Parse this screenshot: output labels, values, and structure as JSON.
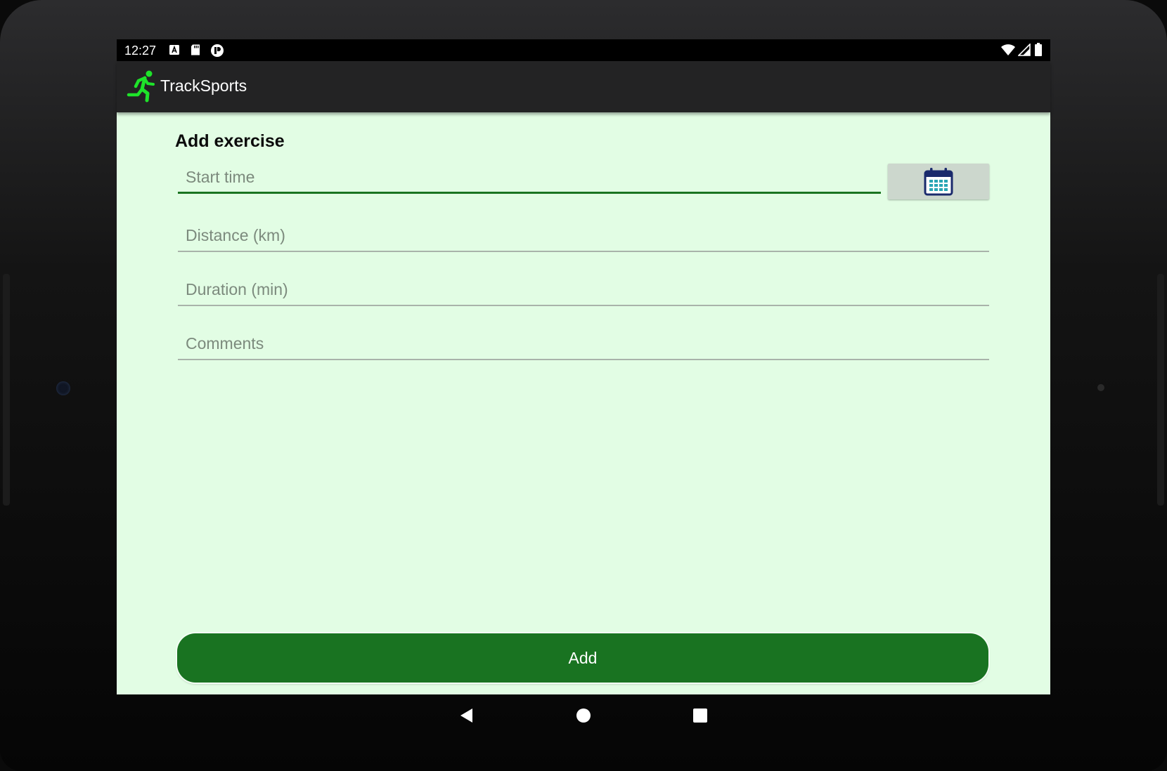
{
  "status_bar": {
    "time": "12:27",
    "left_icons": [
      "keyboard-a-icon",
      "sd-card-icon",
      "app-notification-icon"
    ],
    "right_icons": [
      "wifi-icon",
      "signal-icon",
      "battery-icon"
    ]
  },
  "app_bar": {
    "title": "TrackSports",
    "logo_icon": "running-person-icon",
    "logo_color": "#1ee32a"
  },
  "form": {
    "title": "Add exercise",
    "fields": {
      "start_time": {
        "placeholder": "Start time",
        "value": ""
      },
      "distance": {
        "placeholder": "Distance (km)",
        "value": ""
      },
      "duration": {
        "placeholder": "Duration (min)",
        "value": ""
      },
      "comments": {
        "placeholder": "Comments",
        "value": ""
      }
    },
    "calendar_button_icon": "calendar-icon",
    "add_label": "Add"
  },
  "colors": {
    "content_background": "#e2fde4",
    "primary_button": "#197321",
    "focused_underline": "#1a7420",
    "app_bar": "#232324"
  },
  "nav_bar": {
    "icons": [
      "back-icon",
      "home-icon",
      "recents-icon"
    ]
  }
}
